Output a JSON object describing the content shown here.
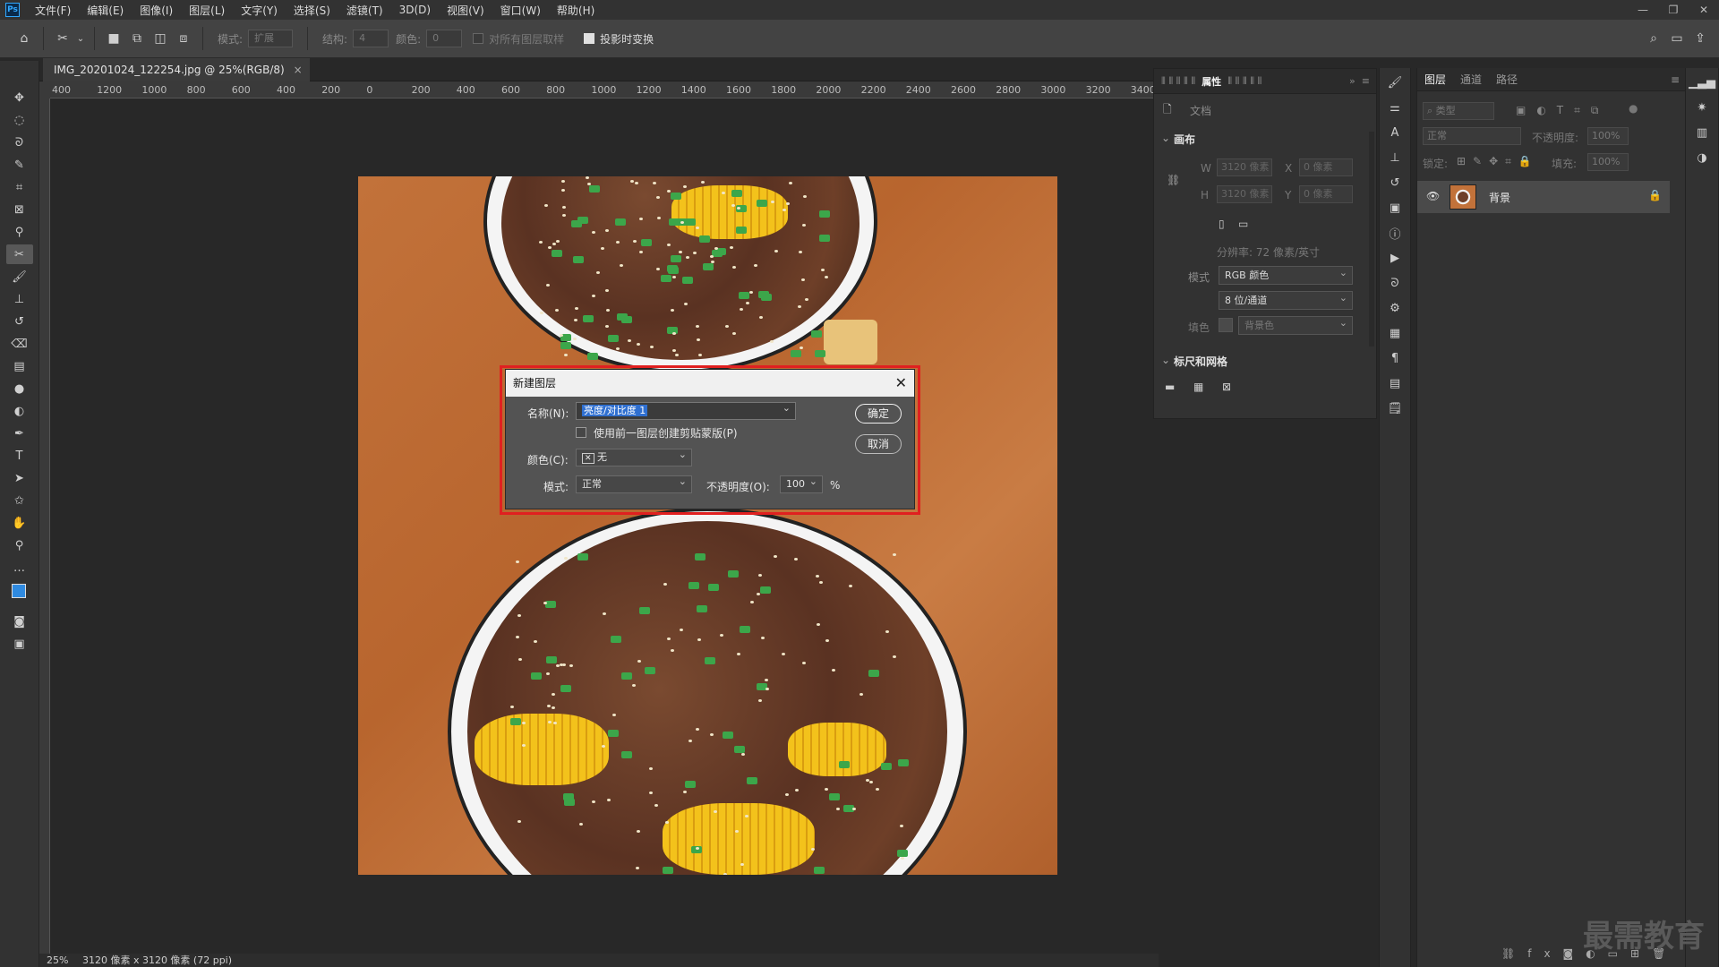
{
  "app": {
    "logo": "Ps"
  },
  "menu": [
    "文件(F)",
    "编辑(E)",
    "图像(I)",
    "图层(L)",
    "文字(Y)",
    "选择(S)",
    "滤镜(T)",
    "3D(D)",
    "视图(V)",
    "窗口(W)",
    "帮助(H)"
  ],
  "options": {
    "mode_label": "模式:",
    "mode_value": "扩展",
    "structure_label": "结构:",
    "structure_value": "4",
    "color_label": "颜色:",
    "color_value": "0",
    "sample_all_label": "对所有图层取样",
    "transform_label": "投影时变换"
  },
  "document": {
    "tab_title": "IMG_20201024_122254.jpg @ 25%(RGB/8)",
    "ruler_ticks": [
      "400",
      "1200",
      "1000",
      "800",
      "600",
      "400",
      "200",
      "0",
      "200",
      "400",
      "600",
      "800",
      "1000",
      "1200",
      "1400",
      "1600",
      "1800",
      "2000",
      "2200",
      "2400",
      "2600",
      "2800",
      "3000",
      "3200",
      "3400"
    ]
  },
  "status": {
    "zoom": "25%",
    "info": "3120 像素 x 3120 像素 (72 ppi)"
  },
  "properties": {
    "tabs": [
      "属性"
    ],
    "doc_label": "文档",
    "canvas_section": "画布",
    "w_label": "W",
    "w_value": "3120 像素",
    "h_label": "H",
    "h_value": "3120 像素",
    "x_label": "X",
    "x_value": "0 像素",
    "y_label": "Y",
    "y_value": "0 像素",
    "resolution": "分辨率: 72 像素/英寸",
    "mode_label": "模式",
    "mode_value": "RGB 颜色",
    "depth_value": "8 位/通道",
    "fill_label": "填色",
    "fill_value": "背景色",
    "rulers_section": "标尺和网格"
  },
  "layers": {
    "tabs": [
      "图层",
      "通道",
      "路径"
    ],
    "filter_label": "类型",
    "blend_mode": "正常",
    "opacity_label": "不透明度:",
    "opacity_value": "100%",
    "lock_label": "锁定:",
    "fill_label": "填充:",
    "fill_value": "100%",
    "layer_name": "背景"
  },
  "dialog": {
    "title": "新建图层",
    "name_label": "名称(N):",
    "name_value": "亮度/对比度 1",
    "clip_label": "使用前一图层创建剪贴蒙版(P)",
    "color_label": "颜色(C):",
    "color_value": "无",
    "mode_label": "模式:",
    "mode_value": "正常",
    "opacity_label": "不透明度(O):",
    "opacity_value": "100",
    "percent": "%",
    "ok_label": "确定",
    "cancel_label": "取消"
  },
  "watermark": "最需教育"
}
